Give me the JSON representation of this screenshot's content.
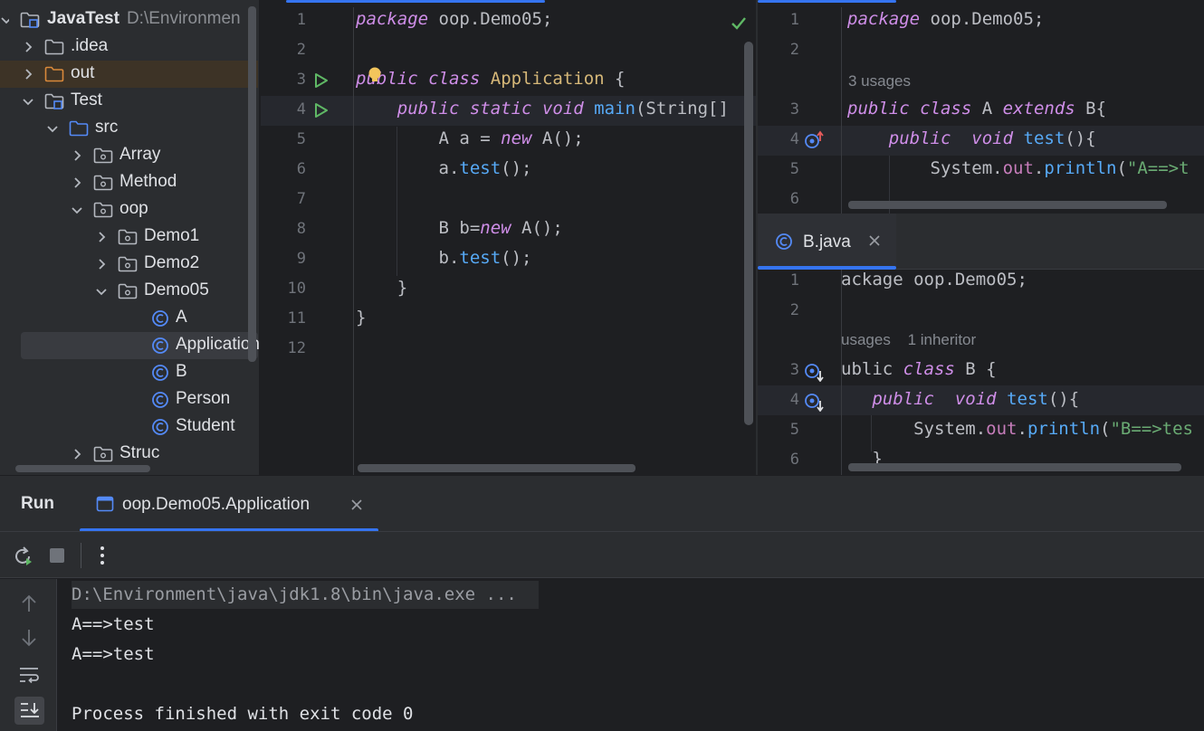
{
  "project_tree": {
    "root": {
      "name": "JavaTest",
      "path": "D:\\Environmen"
    },
    "items": [
      {
        "label": ".idea",
        "indent": 0,
        "kind": "folder",
        "chevron": "right"
      },
      {
        "label": "out",
        "indent": 0,
        "kind": "folder-orange",
        "chevron": "right"
      },
      {
        "label": "Test",
        "indent": 0,
        "kind": "module",
        "chevron": "down"
      },
      {
        "label": "src",
        "indent": 1,
        "kind": "source-folder",
        "chevron": "down"
      },
      {
        "label": "Array",
        "indent": 2,
        "kind": "package",
        "chevron": "right"
      },
      {
        "label": "Method",
        "indent": 2,
        "kind": "package",
        "chevron": "right"
      },
      {
        "label": "oop",
        "indent": 2,
        "kind": "package",
        "chevron": "down"
      },
      {
        "label": "Demo1",
        "indent": 3,
        "kind": "package",
        "chevron": "right"
      },
      {
        "label": "Demo2",
        "indent": 3,
        "kind": "package",
        "chevron": "right"
      },
      {
        "label": "Demo05",
        "indent": 3,
        "kind": "package",
        "chevron": "down"
      },
      {
        "label": "A",
        "indent": 4,
        "kind": "class"
      },
      {
        "label": "Application",
        "indent": 4,
        "kind": "class",
        "selected": true
      },
      {
        "label": "B",
        "indent": 4,
        "kind": "class"
      },
      {
        "label": "Person",
        "indent": 4,
        "kind": "class"
      },
      {
        "label": "Student",
        "indent": 4,
        "kind": "class"
      },
      {
        "label": "Struc",
        "indent": 2,
        "kind": "package",
        "chevron": "right"
      }
    ]
  },
  "editor_main": {
    "line_numbers": [
      "1",
      "2",
      "3",
      "4",
      "5",
      "6",
      "7",
      "8",
      "9",
      "10",
      "11",
      "12"
    ],
    "code": [
      [
        [
          "kw",
          "package"
        ],
        [
          "t",
          " oop.Demo05;"
        ]
      ],
      [],
      [
        [
          "kw",
          "public"
        ],
        [
          "t",
          " "
        ],
        [
          "kw",
          "class"
        ],
        [
          "t",
          " "
        ],
        [
          "cls",
          "Application"
        ],
        [
          "t",
          " {"
        ]
      ],
      [
        [
          "t",
          "    "
        ],
        [
          "kw",
          "public"
        ],
        [
          "t",
          " "
        ],
        [
          "kw",
          "static"
        ],
        [
          "t",
          " "
        ],
        [
          "kw",
          "void"
        ],
        [
          "t",
          " "
        ],
        [
          "fn",
          "main"
        ],
        [
          "t",
          "(String[]"
        ]
      ],
      [
        [
          "t",
          "        A a = "
        ],
        [
          "kw",
          "new"
        ],
        [
          "t",
          " A();"
        ]
      ],
      [
        [
          "t",
          "        a."
        ],
        [
          "fn",
          "test"
        ],
        [
          "t",
          "();"
        ]
      ],
      [],
      [
        [
          "t",
          "        B b="
        ],
        [
          "kw",
          "new"
        ],
        [
          "t",
          " A();"
        ]
      ],
      [
        [
          "t",
          "        b."
        ],
        [
          "fn",
          "test"
        ],
        [
          "t",
          "();"
        ]
      ],
      [
        [
          "t",
          "    }"
        ]
      ],
      [
        [
          "t",
          "}"
        ]
      ],
      []
    ]
  },
  "editor_a": {
    "line_numbers": [
      "1",
      "2",
      "3",
      "4",
      "5",
      "6"
    ],
    "usages_hint": "3 usages",
    "code": [
      [
        [
          "kw",
          "package"
        ],
        [
          "t",
          " oop.Demo05;"
        ]
      ],
      [],
      [
        [
          "kw",
          "public"
        ],
        [
          "t",
          " "
        ],
        [
          "kw",
          "class"
        ],
        [
          "t",
          " A "
        ],
        [
          "kw",
          "extends"
        ],
        [
          "t",
          " B{"
        ]
      ],
      [
        [
          "t",
          "    "
        ],
        [
          "kw",
          "public"
        ],
        [
          "t",
          "  "
        ],
        [
          "kw",
          "void"
        ],
        [
          "t",
          " "
        ],
        [
          "fn",
          "test"
        ],
        [
          "t",
          "(){"
        ]
      ],
      [
        [
          "t",
          "        System."
        ],
        [
          "fld",
          "out"
        ],
        [
          "t",
          "."
        ],
        [
          "fn",
          "println"
        ],
        [
          "t",
          "("
        ],
        [
          "str",
          "\"A==>t"
        ]
      ],
      []
    ]
  },
  "editor_b": {
    "tab_label": "B.java",
    "line_numbers": [
      "1",
      "2",
      "3",
      "4",
      "5",
      "6"
    ],
    "usages_hint": "usages",
    "inheritor_hint": "1 inheritor",
    "code": [
      [
        [
          "t",
          "ackage"
        ],
        [
          "t",
          " oop.Demo05;"
        ]
      ],
      [],
      [
        [
          "t",
          "ublic"
        ],
        [
          "t",
          " "
        ],
        [
          "kw",
          "class"
        ],
        [
          "t",
          " B {"
        ]
      ],
      [
        [
          "t",
          "   "
        ],
        [
          "kw",
          "public"
        ],
        [
          "t",
          "  "
        ],
        [
          "kw",
          "void"
        ],
        [
          "t",
          " "
        ],
        [
          "fn",
          "test"
        ],
        [
          "t",
          "(){"
        ]
      ],
      [
        [
          "t",
          "       System."
        ],
        [
          "fld",
          "out"
        ],
        [
          "t",
          "."
        ],
        [
          "fn",
          "println"
        ],
        [
          "t",
          "("
        ],
        [
          "str",
          "\"B==>tes"
        ]
      ],
      [
        [
          "t",
          "   }"
        ]
      ]
    ]
  },
  "run_panel": {
    "title": "Run",
    "tab_label": "oop.Demo05.Application",
    "console_lines": [
      "D:\\Environment\\java\\jdk1.8\\bin\\java.exe ...",
      "A==>test",
      "A==>test",
      "",
      "Process finished with exit code 0"
    ]
  },
  "colors": {
    "accent": "#3574f0",
    "keyword": "#cf8ee8",
    "method": "#57aaf7",
    "string": "#6aab73",
    "field": "#c77dbb",
    "class_name": "#d5b778",
    "run_green": "#5fb865",
    "inspection_ok": "#5fb865"
  }
}
